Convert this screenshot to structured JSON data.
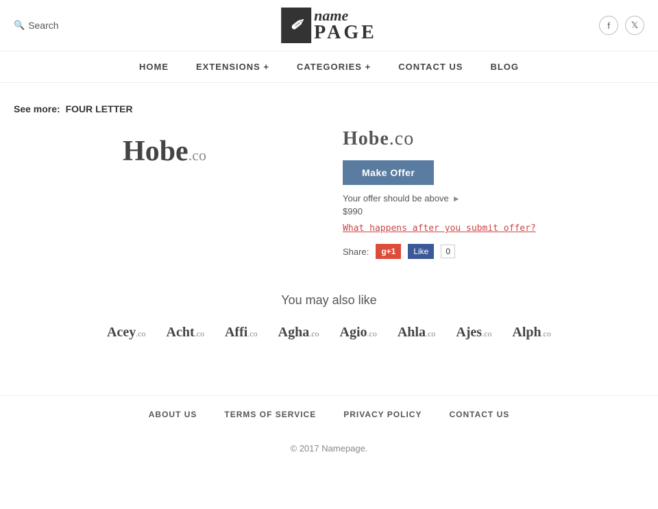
{
  "header": {
    "search_label": "Search",
    "logo_icon": "n",
    "logo_name": "name",
    "logo_page": "PAGE"
  },
  "nav": {
    "items": [
      {
        "label": "HOME",
        "id": "home"
      },
      {
        "label": "EXTENSIONS +",
        "id": "extensions"
      },
      {
        "label": "CATEGORIES +",
        "id": "categories"
      },
      {
        "label": "CONTACT US",
        "id": "contact"
      },
      {
        "label": "BLOG",
        "id": "blog"
      }
    ]
  },
  "breadcrumb": {
    "see_more": "See more:",
    "link_text": "FOUR LETTER"
  },
  "product": {
    "domain_name": "Hobe",
    "tld": ".co",
    "full_domain": "Hobe.co",
    "make_offer_label": "Make Offer",
    "offer_info": "Your offer should be above",
    "offer_amount": "$990",
    "what_happens_link": "What happens after you submit offer?",
    "share_label": "Share:",
    "gplus_label": "g+1",
    "fb_like_label": "Like",
    "fb_count": "0"
  },
  "also_like": {
    "title": "You may also like",
    "domains": [
      {
        "name": "Acey",
        "tld": ".co"
      },
      {
        "name": "Acht",
        "tld": ".co"
      },
      {
        "name": "Affi",
        "tld": ".co"
      },
      {
        "name": "Agha",
        "tld": ".co"
      },
      {
        "name": "Agio",
        "tld": ".co"
      },
      {
        "name": "Ahla",
        "tld": ".co"
      },
      {
        "name": "Ajes",
        "tld": ".co"
      },
      {
        "name": "Alph",
        "tld": ".co"
      }
    ]
  },
  "footer": {
    "nav_items": [
      {
        "label": "ABOUT US",
        "id": "about"
      },
      {
        "label": "TERMS OF SERVICE",
        "id": "terms"
      },
      {
        "label": "PRIVACY POLICY",
        "id": "privacy"
      },
      {
        "label": "CONTACT US",
        "id": "contact"
      }
    ],
    "copyright": "© 2017",
    "brand": "Namepage."
  }
}
